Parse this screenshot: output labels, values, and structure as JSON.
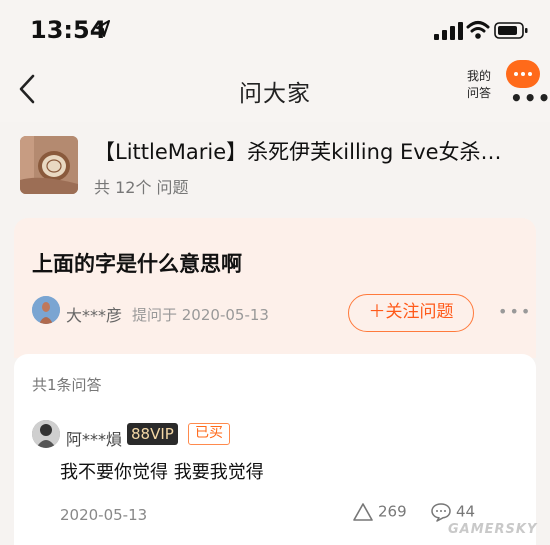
{
  "status": {
    "time": "13:54"
  },
  "nav": {
    "title": "问大家",
    "my_qa_line1": "我的",
    "my_qa_line2": "问答"
  },
  "product": {
    "title": "【LittleMarie】杀死伊芙killing Eve女杀…",
    "question_count": "共 12个 问题"
  },
  "question": {
    "title": "上面的字是什么意思啊",
    "asker": "大***彦",
    "meta": "提问于 2020-05-13",
    "follow_label": "＋关注问题"
  },
  "answers": {
    "count_label": "共1条问答",
    "items": [
      {
        "name": "阿***熉",
        "vip": "88VIP",
        "badge": "已买",
        "text": "我不要你觉得 我要我觉得",
        "date": "2020-05-13",
        "likes": "269",
        "comments": "44"
      }
    ]
  },
  "watermark": "GAMERSKY",
  "colors": {
    "accent": "#ff6a1a",
    "card_bg": "#fdf0ea"
  },
  "icons": [
    "location-arrow-icon",
    "signal-icon",
    "wifi-icon",
    "battery-icon",
    "back-chevron-icon",
    "more-icon",
    "like-icon",
    "comment-icon"
  ]
}
